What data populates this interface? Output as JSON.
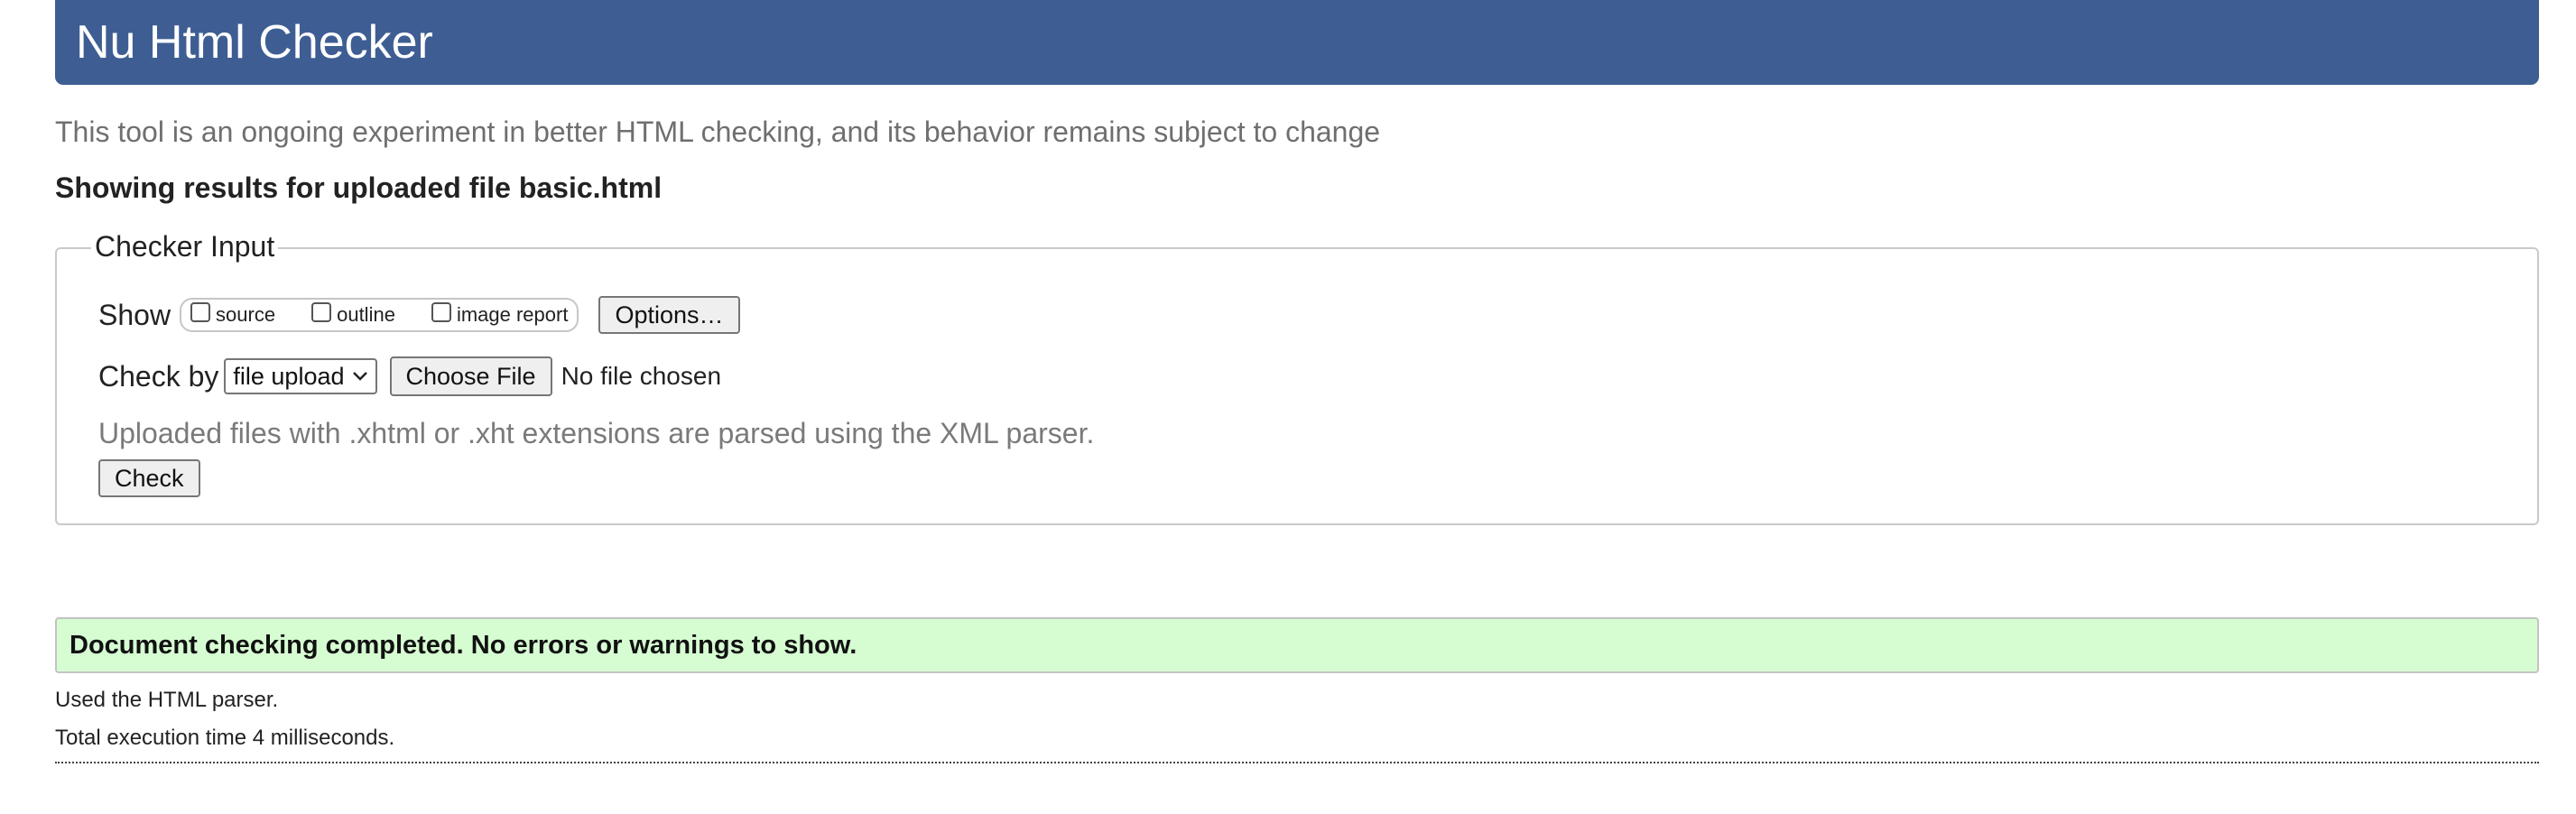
{
  "header": {
    "title": "Nu Html Checker",
    "subtitle": "This tool is an ongoing experiment in better HTML checking, and its behavior remains subject to change"
  },
  "results": {
    "heading": "Showing results for uploaded file basic.html"
  },
  "checker_input": {
    "legend": "Checker Input",
    "show_label": "Show",
    "show_options": [
      {
        "label": "source",
        "checked": false
      },
      {
        "label": "outline",
        "checked": false
      },
      {
        "label": "image report",
        "checked": false
      }
    ],
    "options_button": "Options…",
    "check_by_label": "Check by",
    "check_by_selected": "file upload",
    "choose_file_button": "Choose File",
    "no_file_text": "No file chosen",
    "note": "Uploaded files with .xhtml or .xht extensions are parsed using the XML parser.",
    "check_button": "Check"
  },
  "status": {
    "message": "Document checking completed. No errors or warnings to show.",
    "parser_info": "Used the HTML parser.",
    "execution_time": "Total execution time 4 milliseconds."
  },
  "colors": {
    "banner": "#3e5e93",
    "success_background": "#d6fcd2"
  },
  "icons": {
    "select_arrow": "chevron-down-icon"
  }
}
